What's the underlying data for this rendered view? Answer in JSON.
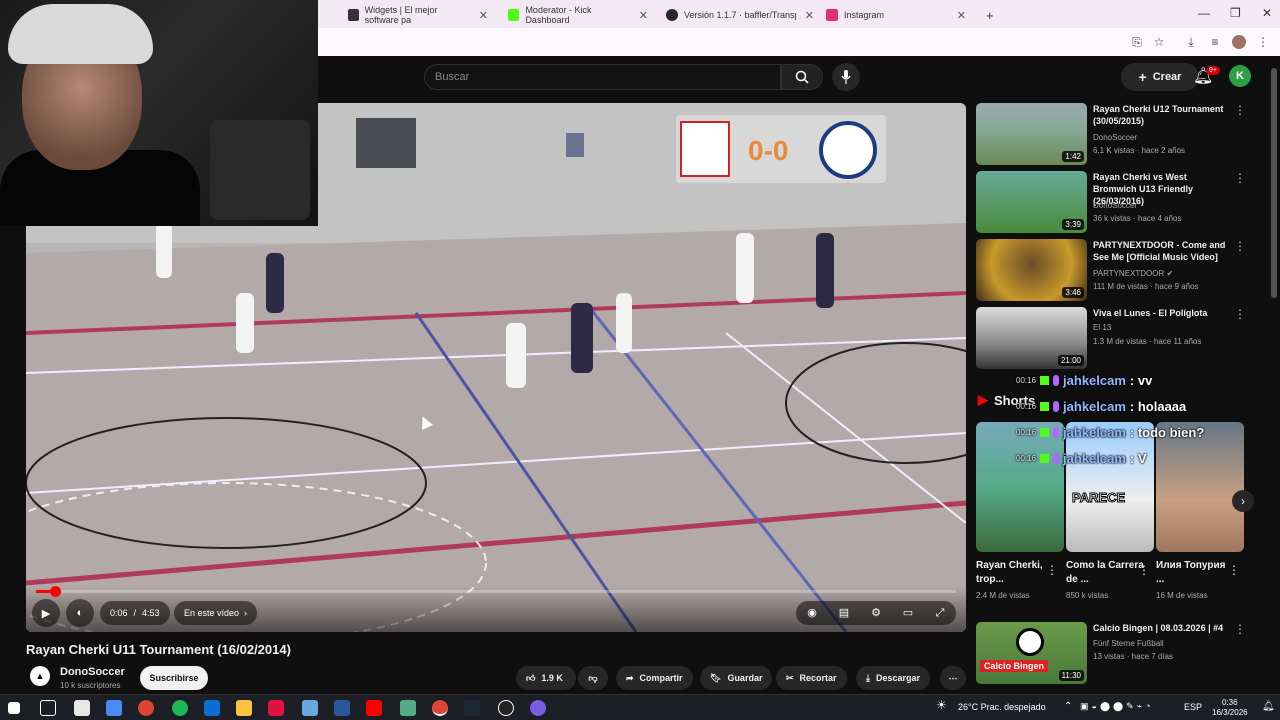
{
  "browser": {
    "tabs": [
      {
        "label": "Widgets | El mejor software pa",
        "color": "#333333"
      },
      {
        "label": "Moderator - Kick Dashboard",
        "color": "#53fc18"
      },
      {
        "label": "Versión 1.1.7 · baffler/Transpare",
        "color": "#24292f"
      },
      {
        "label": "Instagram",
        "color": "#e1306c"
      }
    ],
    "new_tab": "+"
  },
  "youtube": {
    "search_placeholder": "Buscar",
    "create_label": "Crear",
    "notif_badge": "9+",
    "avatar_letter": "K"
  },
  "player": {
    "score": "0-0",
    "time_current": "0:06",
    "time_total": "4:53",
    "time_sep": "/",
    "chapter": "En este vídeo",
    "progress_fraction": 0.021
  },
  "video": {
    "title": "Rayan Cherki U11 Tournament (16/02/2014)",
    "channel": "DonoSoccer",
    "subscribers": "10 k suscriptores",
    "subscribe_label": "Suscribirse",
    "likes": "1.9 K",
    "share": "Compartir",
    "save": "Guardar",
    "clip": "Recortar",
    "download": "Descargar"
  },
  "recommendations": [
    {
      "title": "Rayan Cherki U12 Tournament (30/05/2015)",
      "channel": "DonoSoccer",
      "meta": "6.1 K vistas · hace 2 años",
      "duration": "1:42"
    },
    {
      "title": "Rayan Cherki vs West Bromwich U13 Friendly (26/03/2016)",
      "channel": "DonoSoccer",
      "meta": "36 k vistas · hace 4 años",
      "duration": "3:39"
    },
    {
      "title": "PARTYNEXTDOOR - Come and See Me [Official Music Video]",
      "channel": "PARTYNEXTDOOR",
      "meta": "111 M de vistas · hace 9 años",
      "duration": "3:46"
    },
    {
      "title": "Viva el Lunes - El Políglota",
      "channel": "El 13",
      "meta": "1.3 M de vistas · hace 11 años",
      "duration": "21:00"
    }
  ],
  "chat": [
    {
      "time": "00:16",
      "user": "jahkelcam",
      "msg": ": vv"
    },
    {
      "time": "00:16",
      "user": "jahkelcam",
      "msg": ": holaaaa"
    },
    {
      "time": "00:16",
      "user": "jahkelcam",
      "msg": ": todo bien?"
    },
    {
      "time": "00:16",
      "user": "jahkelcam",
      "msg": ": V"
    }
  ],
  "shorts": {
    "label": "Shorts",
    "items": [
      {
        "title": "Rayan Cherki, trop...",
        "meta": "2.4 M de vistas"
      },
      {
        "title": "Como la Carrera de ...",
        "meta": "850 k vistas",
        "overlay": "PARECE"
      },
      {
        "title": "Илия Топурия ...",
        "meta": "16 M de vistas"
      }
    ]
  },
  "last_rec": {
    "title": "Calcio Bingen | 08.03.2026 | #4",
    "channel": "Fünf Sterne Fußball",
    "meta": "13 vistas · hace 7 días",
    "duration": "11:30",
    "thumb_text": "Calcio Bingen"
  },
  "taskbar": {
    "weather": "26°C  Prac. despejado",
    "lang": "ESP",
    "time": "0:36",
    "date": "16/3/2026"
  }
}
